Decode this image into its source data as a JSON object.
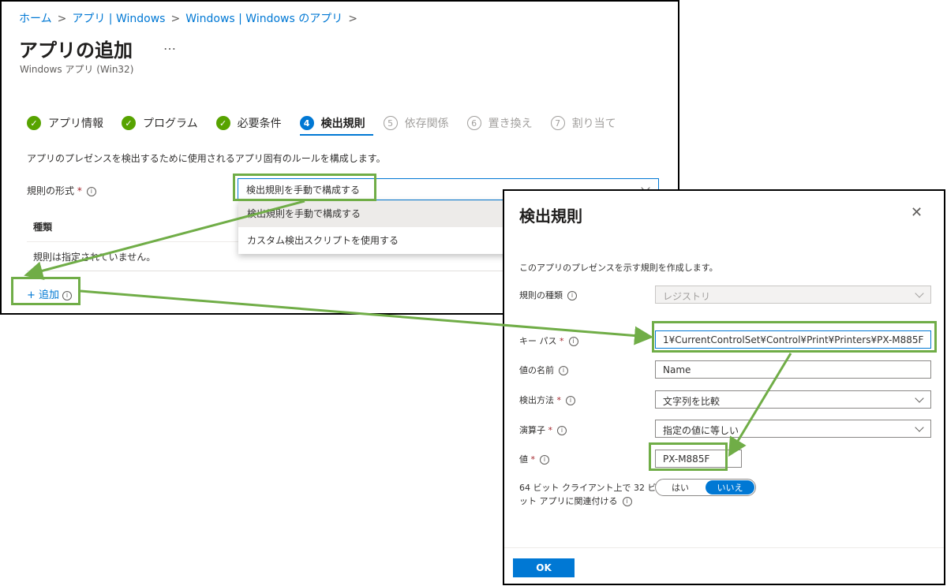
{
  "back_window": {
    "breadcrumb": [
      "ホーム",
      "アプリ | Windows",
      "Windows | Windows のアプリ"
    ],
    "breadcrumb_sep": ">",
    "title": "アプリの追加",
    "more": "…",
    "subtitle": "Windows アプリ (Win32)",
    "steps": [
      {
        "mark": "✓",
        "label": "アプリ情報"
      },
      {
        "mark": "✓",
        "label": "プログラム"
      },
      {
        "mark": "✓",
        "label": "必要条件"
      },
      {
        "mark": "4",
        "label": "検出規則"
      },
      {
        "mark": "5",
        "label": "依存関係"
      },
      {
        "mark": "6",
        "label": "置き換え"
      },
      {
        "mark": "7",
        "label": "割り当て"
      }
    ],
    "description": "アプリのプレゼンスを検出するために使用されるアプリ固有のルールを構成します。",
    "rule_format_label": "規則の形式",
    "required_mark": "*",
    "rule_format_value": "検出規則を手動で構成する",
    "dropdown_options": [
      "検出規則を手動で構成する",
      "カスタム検出スクリプトを使用する"
    ],
    "table_header": "種類",
    "table_empty": "規則は指定されていません。",
    "add_label": "+ 追加"
  },
  "dialog": {
    "title": "検出規則",
    "close": "✕",
    "description": "このアプリのプレゼンスを示す規則を作成します。",
    "rule_type_label": "規則の種類",
    "rule_type_value": "レジストリ",
    "key_path_label": "キー パス",
    "key_path_value": "1¥CurrentControlSet¥Control¥Print¥Printers¥PX-M885F",
    "value_name_label": "値の名前",
    "value_name_value": "Name",
    "detection_method_label": "検出方法",
    "detection_method_value": "文字列を比較",
    "operator_label": "演算子",
    "operator_value": "指定の値に等しい",
    "value_label": "値",
    "value_value": "PX-M885F",
    "bit64_label_line1": "64 ビット クライアント上で 32 ビ",
    "bit64_label_line2": "ット アプリに関連付ける",
    "toggle_yes": "はい",
    "toggle_no": "いいえ",
    "ok": "OK"
  },
  "colors": {
    "accent": "#0078d4",
    "highlight": "#70ad47",
    "success": "#57a300",
    "required": "#a4262c"
  },
  "icons": [
    "info-icon",
    "chevron-down-icon",
    "close-icon",
    "check-icon"
  ]
}
